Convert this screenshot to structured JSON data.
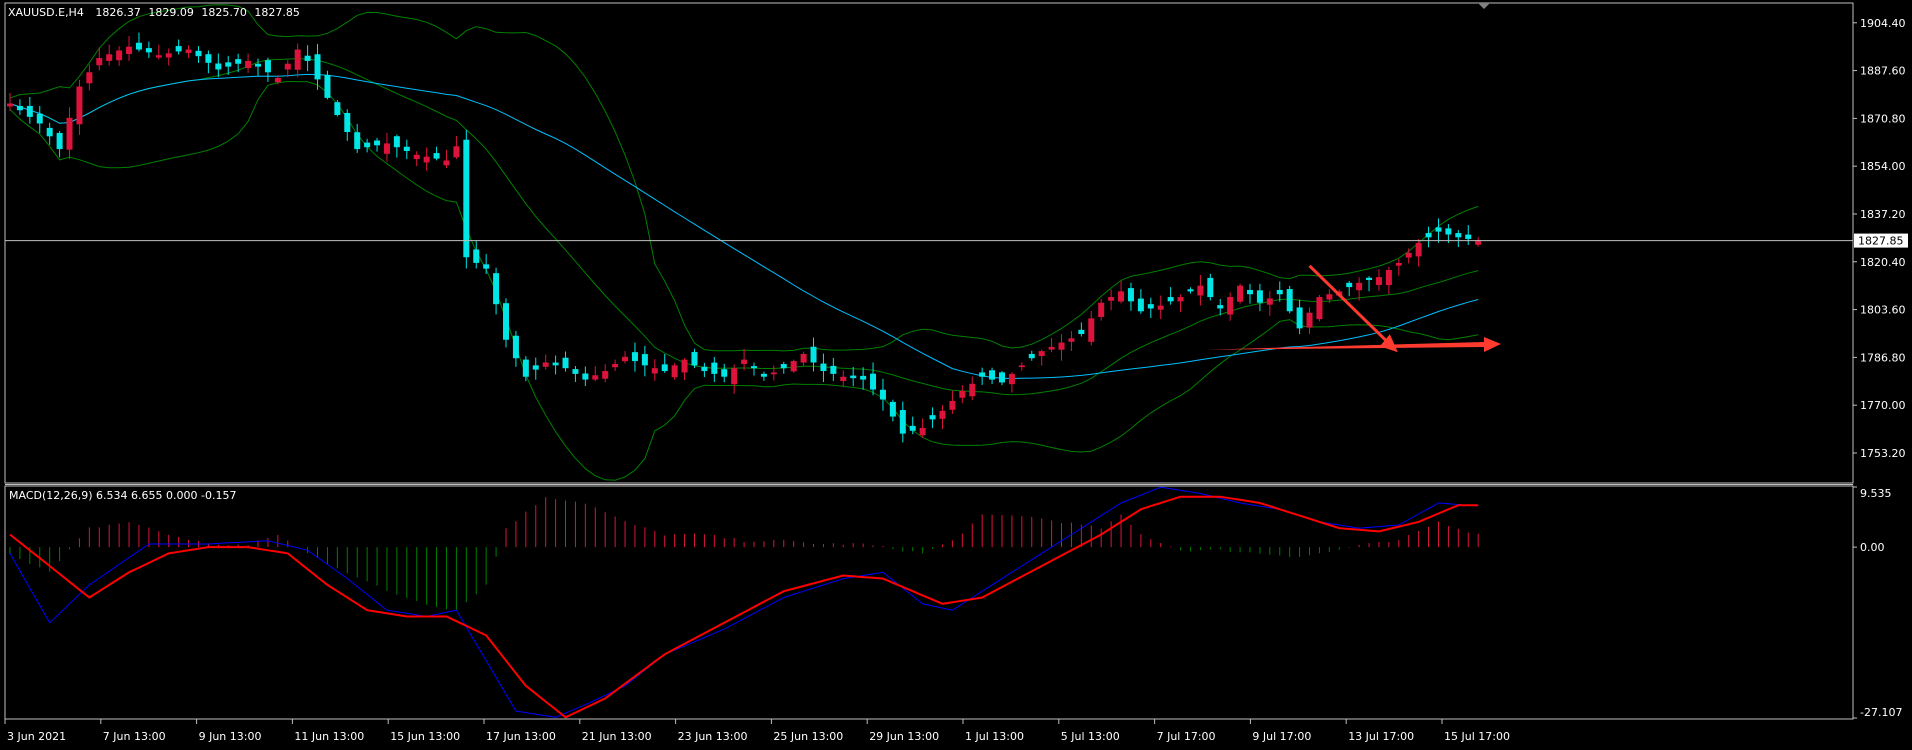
{
  "symbol_info": {
    "symbol": "XAUUSD.E,H4",
    "open": "1826.37",
    "high": "1829.09",
    "low": "1825.70",
    "close": "1827.85"
  },
  "current_price_tag": "1827.85",
  "indicator_label": "MACD(12,26,9) 6.534 6.655 0.000 -0.157",
  "colors": {
    "background": "#000000",
    "bull_candle": "#dc143c",
    "bear_candle": "#00e5e5",
    "bollinger": "#008000",
    "moving_average": "#00bfff",
    "macd_line": "#0000ff",
    "signal_line": "#ff0000",
    "hist_positive": "#dc143c",
    "hist_negative": "#008000",
    "annotation_arrow": "#ff3b30",
    "grid_frame": "#c0c0c0"
  },
  "chart_data": [
    {
      "type": "candlestick",
      "title": "XAUUSD.E,H4",
      "price_axis_ticks": [
        "1904.40",
        "1887.60",
        "1870.80",
        "1854.00",
        "1837.20",
        "1820.40",
        "1803.60",
        "1786.80",
        "1770.00",
        "1753.20"
      ],
      "price_range": [
        1743,
        1911
      ],
      "time_axis_ticks": [
        "3 Jun 2021",
        "7 Jun 13:00",
        "9 Jun 13:00",
        "11 Jun 13:00",
        "15 Jun 13:00",
        "17 Jun 13:00",
        "21 Jun 13:00",
        "23 Jun 13:00",
        "25 Jun 13:00",
        "29 Jun 13:00",
        "1 Jul 13:00",
        "5 Jul 13:00",
        "7 Jul 17:00",
        "9 Jul 17:00",
        "13 Jul 17:00",
        "15 Jul 17:00"
      ],
      "close_anchors": [
        [
          0,
          1876
        ],
        [
          3,
          1869
        ],
        [
          5,
          1860
        ],
        [
          7,
          1882
        ],
        [
          9,
          1892
        ],
        [
          12,
          1896
        ],
        [
          15,
          1893
        ],
        [
          18,
          1895
        ],
        [
          21,
          1888
        ],
        [
          24,
          1891
        ],
        [
          27,
          1885
        ],
        [
          29,
          1895
        ],
        [
          30,
          1891
        ],
        [
          32,
          1878
        ],
        [
          35,
          1860
        ],
        [
          38,
          1862
        ],
        [
          41,
          1858
        ],
        [
          44,
          1856
        ],
        [
          45,
          1861
        ],
        [
          46,
          1822
        ],
        [
          48,
          1818
        ],
        [
          50,
          1793
        ],
        [
          52,
          1780
        ],
        [
          54,
          1785
        ],
        [
          56,
          1783
        ],
        [
          58,
          1779
        ],
        [
          60,
          1782
        ],
        [
          62,
          1787
        ],
        [
          64,
          1784
        ],
        [
          66,
          1782
        ],
        [
          68,
          1786
        ],
        [
          70,
          1782
        ],
        [
          72,
          1780
        ],
        [
          74,
          1786
        ],
        [
          76,
          1780
        ],
        [
          78,
          1783
        ],
        [
          80,
          1788
        ],
        [
          82,
          1782
        ],
        [
          84,
          1780
        ],
        [
          86,
          1779
        ],
        [
          88,
          1772
        ],
        [
          90,
          1760
        ],
        [
          92,
          1762
        ],
        [
          94,
          1768
        ],
        [
          96,
          1775
        ],
        [
          98,
          1780
        ],
        [
          100,
          1778
        ],
        [
          102,
          1784
        ],
        [
          104,
          1789
        ],
        [
          106,
          1792
        ],
        [
          108,
          1795
        ],
        [
          110,
          1806
        ],
        [
          112,
          1810
        ],
        [
          114,
          1803
        ],
        [
          116,
          1805
        ],
        [
          118,
          1808
        ],
        [
          120,
          1812
        ],
        [
          122,
          1804
        ],
        [
          124,
          1812
        ],
        [
          126,
          1806
        ],
        [
          128,
          1809
        ],
        [
          130,
          1797
        ],
        [
          132,
          1808
        ],
        [
          134,
          1810
        ],
        [
          136,
          1813
        ],
        [
          138,
          1815
        ],
        [
          140,
          1820
        ],
        [
          142,
          1827
        ],
        [
          144,
          1831
        ],
        [
          146,
          1829
        ],
        [
          148,
          1827.85
        ]
      ],
      "annotations": [
        "downward red arrow from 7 Jul high to 9 Jul low",
        "horizontal red arrow extending right from 1790"
      ]
    },
    {
      "type": "line",
      "title": "MACD(12,26,9)",
      "values_text": "6.534 6.655 0.000 -0.157",
      "y_axis_ticks": [
        "9.535",
        "0.00",
        "-27.107"
      ],
      "y_range": [
        -27.107,
        9.535
      ],
      "series": [
        {
          "name": "MACD",
          "anchors": [
            [
              0,
              -1
            ],
            [
              4,
              -12
            ],
            [
              8,
              -6
            ],
            [
              14,
              0.5
            ],
            [
              20,
              0.5
            ],
            [
              26,
              1
            ],
            [
              30,
              -0.5
            ],
            [
              34,
              -5
            ],
            [
              38,
              -10
            ],
            [
              42,
              -11
            ],
            [
              45,
              -10
            ],
            [
              48,
              -18
            ],
            [
              51,
              -26
            ],
            [
              55,
              -27
            ],
            [
              58,
              -25
            ],
            [
              62,
              -22
            ],
            [
              66,
              -17
            ],
            [
              72,
              -13
            ],
            [
              78,
              -8
            ],
            [
              84,
              -5
            ],
            [
              88,
              -4
            ],
            [
              92,
              -9
            ],
            [
              95,
              -10
            ],
            [
              98,
              -7
            ],
            [
              104,
              -1
            ],
            [
              108,
              3
            ],
            [
              112,
              7
            ],
            [
              116,
              9.5
            ],
            [
              120,
              8.5
            ],
            [
              124,
              7
            ],
            [
              128,
              6
            ],
            [
              132,
              4
            ],
            [
              136,
              3
            ],
            [
              140,
              3.5
            ],
            [
              144,
              7
            ],
            [
              148,
              6.534
            ]
          ]
        },
        {
          "name": "Signal",
          "anchors": [
            [
              0,
              2
            ],
            [
              4,
              -3
            ],
            [
              8,
              -8
            ],
            [
              12,
              -4
            ],
            [
              16,
              -1
            ],
            [
              20,
              0
            ],
            [
              24,
              0
            ],
            [
              28,
              -1
            ],
            [
              32,
              -6
            ],
            [
              36,
              -10
            ],
            [
              40,
              -11
            ],
            [
              44,
              -11
            ],
            [
              48,
              -14
            ],
            [
              52,
              -22
            ],
            [
              56,
              -27
            ],
            [
              60,
              -24
            ],
            [
              66,
              -17
            ],
            [
              72,
              -12
            ],
            [
              78,
              -7
            ],
            [
              84,
              -4.5
            ],
            [
              88,
              -5
            ],
            [
              94,
              -9
            ],
            [
              98,
              -8
            ],
            [
              104,
              -3
            ],
            [
              110,
              2
            ],
            [
              114,
              6
            ],
            [
              118,
              8
            ],
            [
              122,
              8
            ],
            [
              126,
              7
            ],
            [
              130,
              5
            ],
            [
              134,
              3
            ],
            [
              138,
              2.5
            ],
            [
              142,
              4
            ],
            [
              146,
              6.655
            ],
            [
              148,
              6.655
            ]
          ]
        }
      ],
      "histogram_anchors": [
        [
          0,
          -1
        ],
        [
          4,
          -4
        ],
        [
          8,
          3
        ],
        [
          12,
          4
        ],
        [
          16,
          2
        ],
        [
          20,
          0.5
        ],
        [
          24,
          0.3
        ],
        [
          27,
          2
        ],
        [
          30,
          -1
        ],
        [
          34,
          -4
        ],
        [
          38,
          -7
        ],
        [
          42,
          -9
        ],
        [
          45,
          -10
        ],
        [
          48,
          -6
        ],
        [
          50,
          3
        ],
        [
          54,
          8
        ],
        [
          58,
          7
        ],
        [
          62,
          4
        ],
        [
          66,
          2
        ],
        [
          70,
          2
        ],
        [
          74,
          1
        ],
        [
          78,
          1
        ],
        [
          82,
          0.5
        ],
        [
          86,
          0.5
        ],
        [
          88,
          0
        ],
        [
          92,
          -1
        ],
        [
          95,
          1
        ],
        [
          98,
          5
        ],
        [
          102,
          5
        ],
        [
          106,
          4
        ],
        [
          110,
          3
        ],
        [
          112,
          5
        ],
        [
          114,
          2
        ],
        [
          118,
          -0.5
        ],
        [
          122,
          -0.5
        ],
        [
          126,
          -1
        ],
        [
          130,
          -1.5
        ],
        [
          133,
          -0.8
        ],
        [
          136,
          0.3
        ],
        [
          140,
          1
        ],
        [
          144,
          4
        ],
        [
          148,
          2
        ]
      ]
    }
  ]
}
